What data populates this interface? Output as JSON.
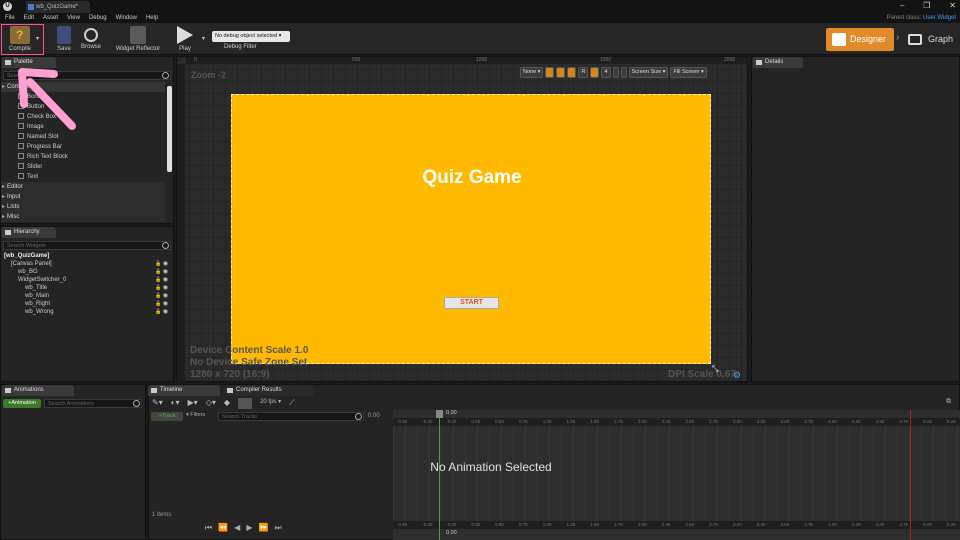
{
  "title_bar": {
    "doc_tab": "wb_QuizGame*",
    "logo": "U"
  },
  "window_controls": [
    "‒",
    "❐",
    "✕"
  ],
  "menu": [
    "File",
    "Edit",
    "Asset",
    "View",
    "Debug",
    "Window",
    "Help"
  ],
  "parent_class": {
    "label": "Parent class:",
    "value": "User Widget"
  },
  "toolbar": {
    "compile": "Compile",
    "save": "Save",
    "browse": "Browse",
    "widget_reflector": "Widget Reflector",
    "play": "Play",
    "debug_select": "No debug object selected",
    "debug_filter": "Debug Filter",
    "designer": "Designer",
    "graph": "Graph"
  },
  "palette": {
    "tab": "Palette",
    "search_placeholder": "Search",
    "common_category": "Common",
    "items": [
      "Border",
      "Button",
      "Check Box",
      "Image",
      "Named Slot",
      "Progress Bar",
      "Rich Text Block",
      "Slider",
      "Text"
    ],
    "categories": [
      "Editor",
      "Input",
      "Lists",
      "Misc"
    ]
  },
  "hierarchy": {
    "tab": "Hierarchy",
    "search_placeholder": "Search Widgets",
    "rows": [
      {
        "label": "[wb_QuizGame]",
        "indent": 0,
        "bold": true,
        "controls": false
      },
      {
        "label": "[Canvas Panel]",
        "indent": 1,
        "bold": false,
        "controls": true
      },
      {
        "label": "wb_BG",
        "indent": 2,
        "bold": false,
        "controls": true
      },
      {
        "label": "WidgetSwitcher_0",
        "indent": 2,
        "bold": false,
        "controls": true
      },
      {
        "label": "wb_Title",
        "indent": 3,
        "bold": false,
        "controls": true
      },
      {
        "label": "wb_Main",
        "indent": 3,
        "bold": false,
        "controls": true
      },
      {
        "label": "wb_Right",
        "indent": 3,
        "bold": false,
        "controls": true
      },
      {
        "label": "wb_Wrong",
        "indent": 3,
        "bold": false,
        "controls": true
      }
    ]
  },
  "designer": {
    "zoom": "Zoom -2",
    "ruler_ticks": [
      "0",
      "500",
      "1000",
      "1500",
      "2000"
    ],
    "tools": {
      "none": "None",
      "four": "4",
      "r": "R",
      "screen_size": "Screen Size",
      "fill_screen": "Fill Screen"
    },
    "widget_title": "Quiz Game",
    "start_button": "START",
    "info": {
      "line1": "Device Content Scale 1.0",
      "line2": "No Device Safe Zone Set",
      "resolution": "1280 x 720 (16:9)",
      "dpi": "DPI Scale 0.67"
    },
    "widget_bg_color": "#ffba00"
  },
  "details": {
    "tab": "Details"
  },
  "animations": {
    "tab": "Animations",
    "add_button": "+Animation",
    "search_placeholder": "Search Animations"
  },
  "timeline": {
    "tabs": [
      "Timeline",
      "Compiler Results"
    ],
    "track_button": "+Track",
    "filters": "Filters",
    "search_placeholder": "Search Tracks",
    "fps": "20 fps",
    "time_value": "0.00",
    "playhead_label": "0.00",
    "items_count": "1 items",
    "ruler_marks": [
      "-0.50",
      "-0.25",
      "0.00",
      "0.25",
      "0.50",
      "0.75",
      "1.00",
      "1.25",
      "1.50",
      "1.75",
      "2.00",
      "2.25",
      "2.50",
      "2.75",
      "3.00",
      "3.25",
      "3.50",
      "3.75",
      "4.00",
      "4.25",
      "4.50",
      "4.75",
      "5.00",
      "5.25"
    ],
    "empty_message": "No Animation Selected",
    "transport": [
      "⏮",
      "⏪",
      "◀",
      "▶",
      "⏩",
      "⏭"
    ]
  }
}
